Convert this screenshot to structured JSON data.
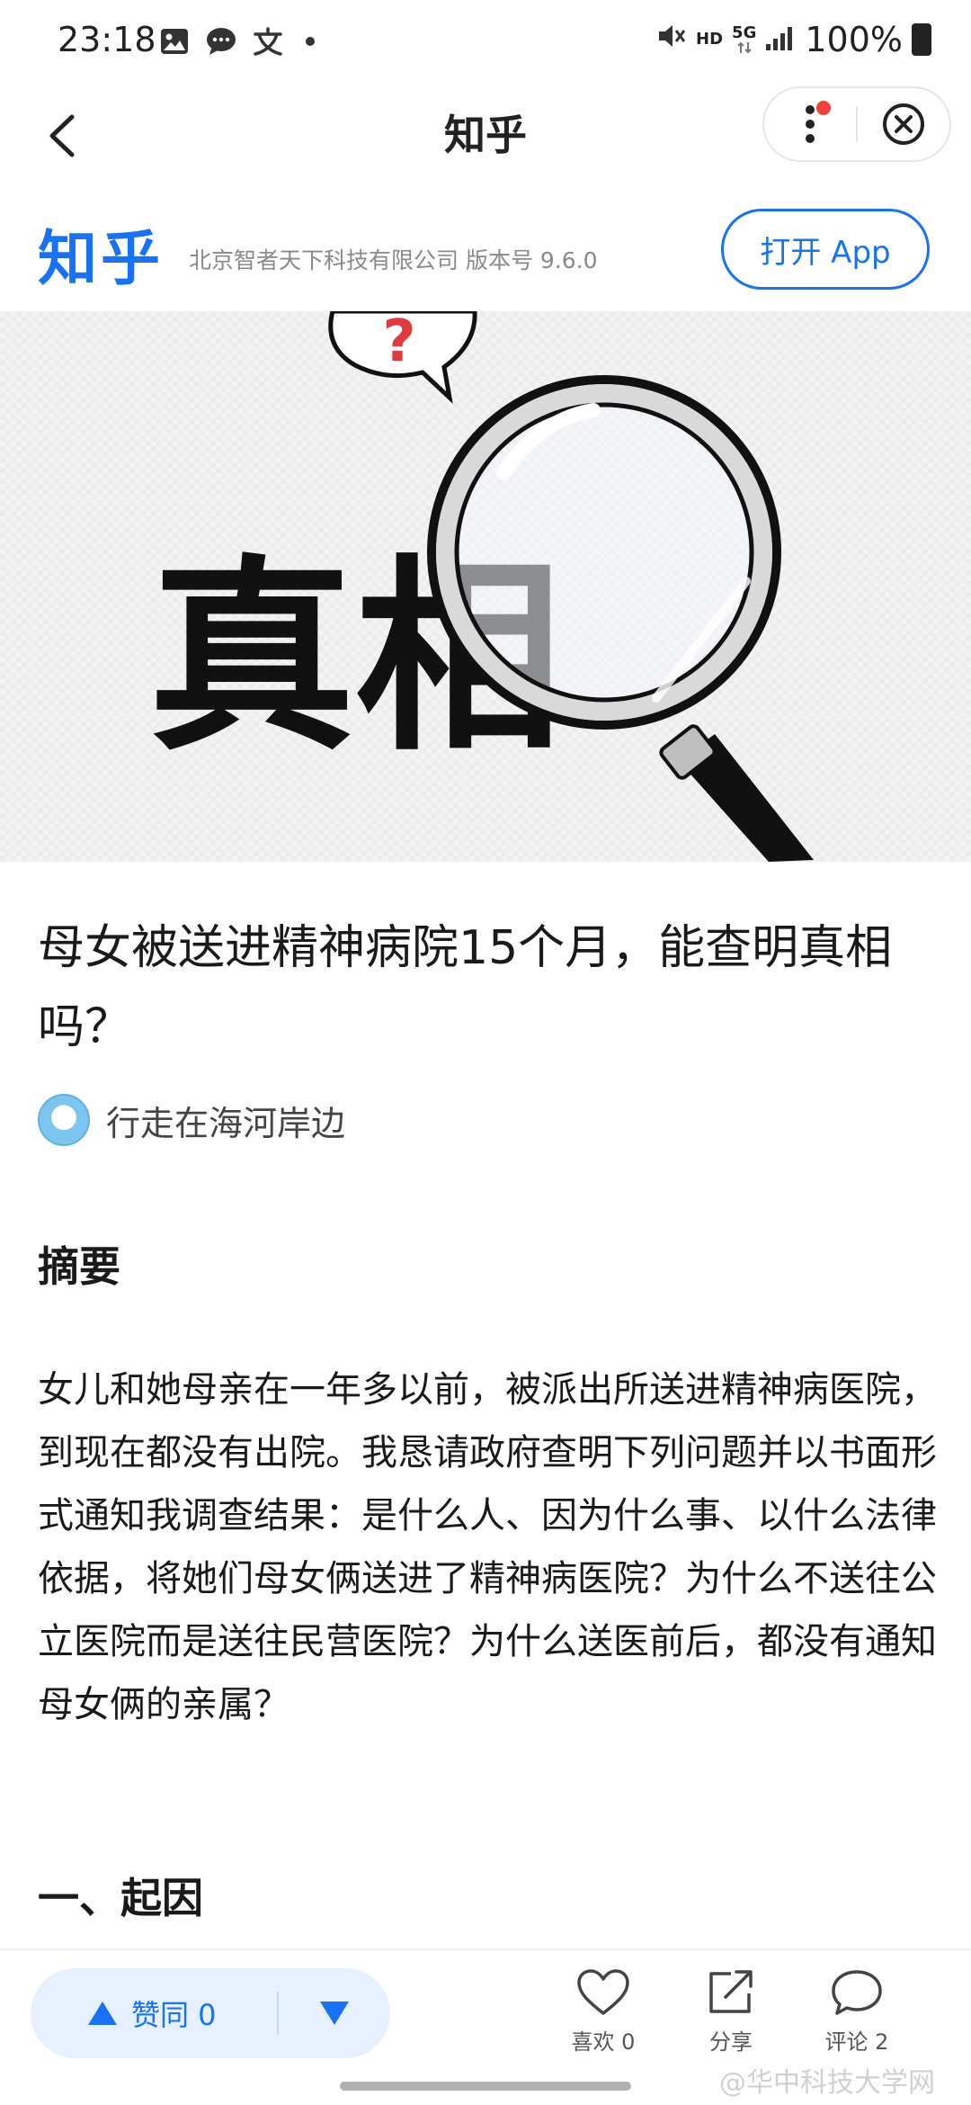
{
  "status_bar": {
    "time": "23:18",
    "network": "HD",
    "network_type": "5G",
    "battery": "100%",
    "icons": [
      "image-icon",
      "chat-bubble-icon",
      "alipay-icon",
      "mute-icon",
      "signal-icon",
      "battery-icon"
    ]
  },
  "titlebar": {
    "title": "知乎"
  },
  "brand": {
    "logo": "知乎",
    "subtitle": "北京智者天下科技有限公司 版本号 9.6.0",
    "open_app": "打开 App"
  },
  "hero": {
    "text": "真相"
  },
  "article": {
    "title": "母女被送进精神病院15个月，能查明真相吗？",
    "author": "行走在海河岸边",
    "section1": "摘要",
    "summary": "女儿和她母亲在一年多以前，被派出所送进精神病医院，到现在都没有出院。我恳请政府查明下列问题并以书面形式通知我调查结果：是什么人、因为什么事、以什么法律依据，将她们母女俩送进了精神病医院？为什么不送往公立医院而是送往民营医院？为什么送医前后，都没有通知母女俩的亲属？",
    "section2": "一、起因"
  },
  "bottom_bar": {
    "upvote": "赞同 0",
    "like": "喜欢 0",
    "share": "分享",
    "comment": "评论 2",
    "accent": "#1772f6"
  },
  "watermark": "@华中科技大学网"
}
